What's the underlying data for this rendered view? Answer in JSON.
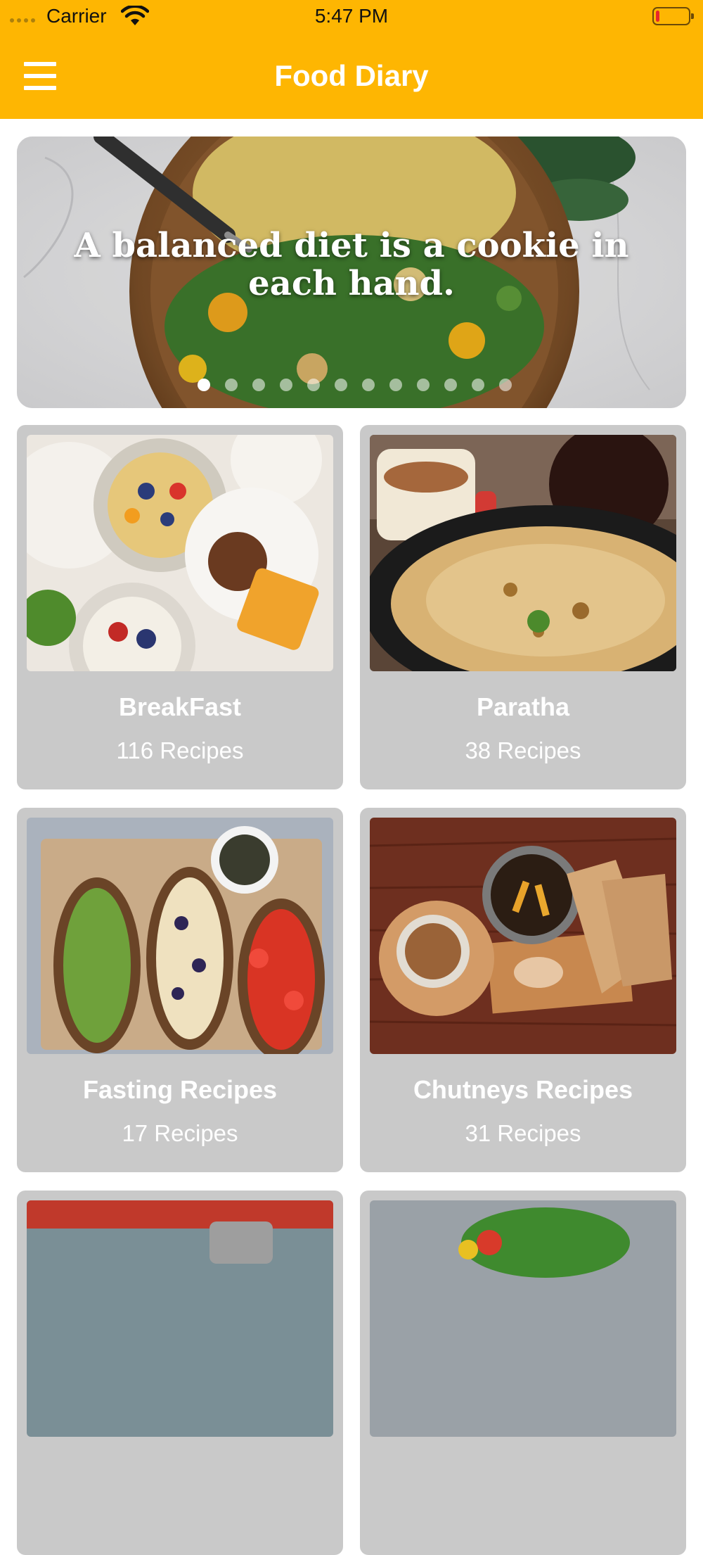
{
  "status_bar": {
    "carrier": "Carrier",
    "time": "5:47 PM",
    "battery_level": 0.1,
    "battery_color": "#e8262c"
  },
  "nav": {
    "title": "Food Diary",
    "menu_icon": "hamburger-menu-icon",
    "background": "#FEB602"
  },
  "banner": {
    "quote": "A balanced diet is a cookie in each hand.",
    "page_count": 12,
    "active_page": 1
  },
  "categories": [
    {
      "name": "BreakFast",
      "count": "116 Recipes"
    },
    {
      "name": "Paratha",
      "count": "38 Recipes"
    },
    {
      "name": "Fasting Recipes",
      "count": "17 Recipes"
    },
    {
      "name": "Chutneys Recipes",
      "count": "31 Recipes"
    },
    {
      "name": "",
      "count": ""
    },
    {
      "name": "",
      "count": ""
    }
  ]
}
